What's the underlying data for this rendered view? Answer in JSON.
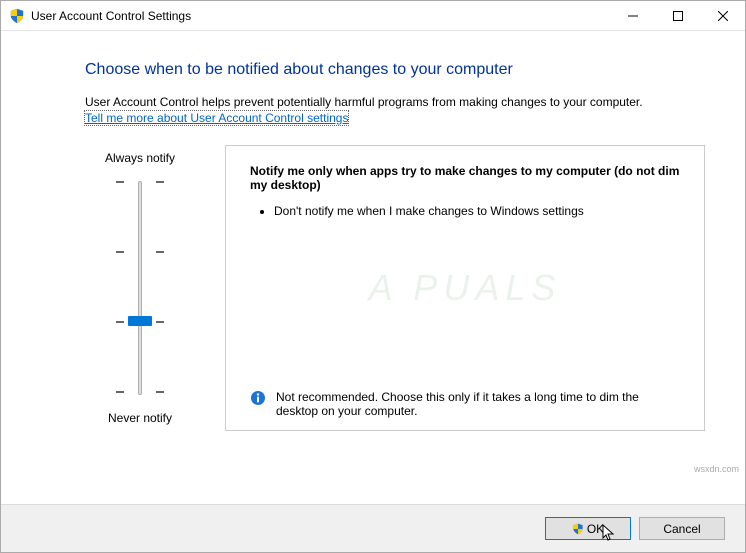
{
  "window": {
    "title": "User Account Control Settings"
  },
  "heading": "Choose when to be notified about changes to your computer",
  "description": "User Account Control helps prevent potentially harmful programs from making changes to your computer.",
  "link_text": "Tell me more about User Account Control settings",
  "slider": {
    "top_label": "Always notify",
    "bottom_label": "Never notify",
    "levels": 4,
    "current_level": 2
  },
  "panel": {
    "title": "Notify me only when apps try to make changes to my computer (do not dim my desktop)",
    "bullet1": "Don't notify me when I make changes to Windows settings",
    "recommendation": "Not recommended. Choose this only if it takes a long time to dim the desktop on your computer."
  },
  "buttons": {
    "ok": "OK",
    "cancel": "Cancel"
  },
  "watermark": "A PUALS",
  "attribution": "wsxdn.com"
}
